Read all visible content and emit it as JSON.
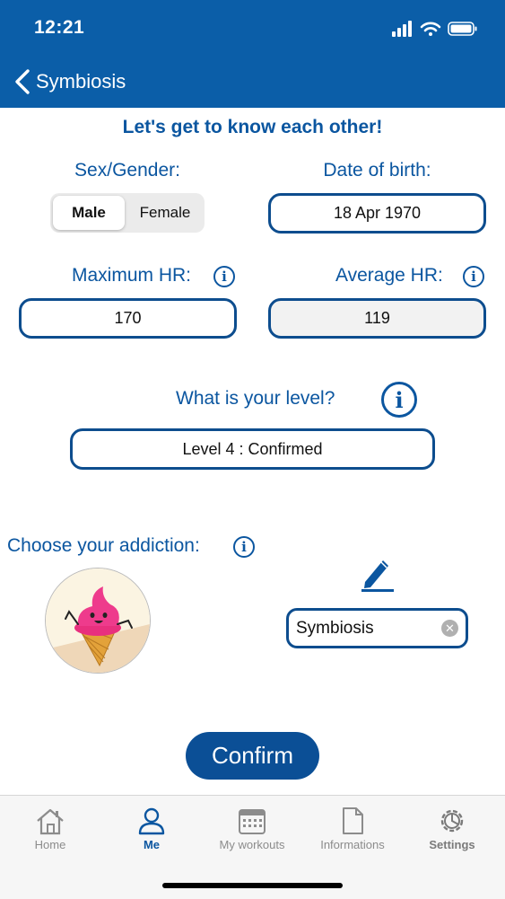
{
  "status_bar": {
    "time": "12:21"
  },
  "nav": {
    "back_label": "Symbiosis"
  },
  "form": {
    "title": "Let's get to know each other!",
    "sex_label": "Sex/Gender:",
    "sex_options": [
      "Male",
      "Female"
    ],
    "sex_selected": "Male",
    "dob_label": "Date of birth:",
    "dob_value": "18 Apr 1970",
    "max_hr_label": "Maximum HR:",
    "max_hr_value": "170",
    "avg_hr_label": "Average HR:",
    "avg_hr_value": "119",
    "level_label": "What is your level?",
    "level_value": "Level 4 : Confirmed",
    "addiction_label": "Choose your addiction:",
    "addiction_name": "Symbiosis"
  },
  "confirm_label": "Confirm",
  "tabbar": {
    "tabs": [
      {
        "label": "Home",
        "icon": "house-icon"
      },
      {
        "label": "Me",
        "icon": "person-icon",
        "active": true
      },
      {
        "label": "My workouts",
        "icon": "calendar-icon"
      },
      {
        "label": "Informations",
        "icon": "document-icon"
      },
      {
        "label": "Settings",
        "icon": "gear-icon"
      }
    ]
  },
  "colors": {
    "brand": "#0b5ea8",
    "accent": "#0b56a0",
    "confirm": "#0b4f96"
  }
}
